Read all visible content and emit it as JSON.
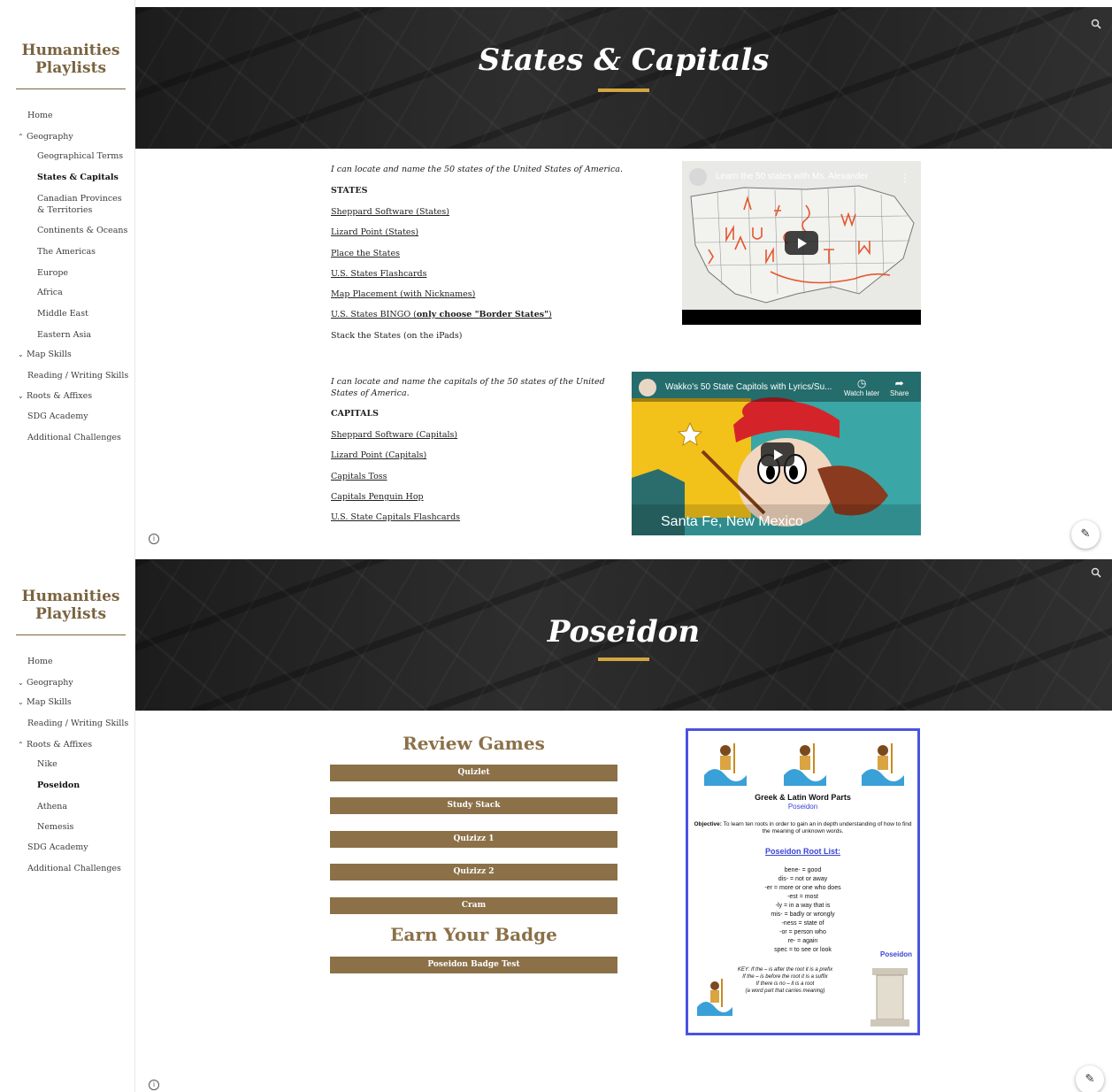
{
  "site": {
    "title_line1": "Humanities",
    "title_line2": "Playlists"
  },
  "screen1": {
    "nav": {
      "home": "Home",
      "geography": "Geography",
      "geo_items": [
        "Geographical Terms",
        "States & Capitals",
        "Canadian Provinces & Territories",
        "Continents & Oceans",
        "The Americas",
        "Europe",
        "Africa",
        "Middle East",
        "Eastern Asia"
      ],
      "map_skills": "Map Skills",
      "reading": "Reading / Writing Skills",
      "roots": "Roots & Affixes",
      "sdg": "SDG Academy",
      "additional": "Additional Challenges"
    },
    "page_title": "States & Capitals",
    "states": {
      "intro": "I can locate and name the 50 states of the United States of America.",
      "heading": "STATES",
      "links": [
        "Sheppard Software (States)",
        "Lizard Point (States)",
        "Place the States",
        "U.S. States Flashcards",
        "Map Placement (with Nicknames)"
      ],
      "bingo_prefix": "U.S. States BINGO (",
      "bingo_emph": "only choose \"Border States\"",
      "bingo_suffix": ")",
      "stack": "Stack the States (on the iPads)"
    },
    "capitals": {
      "intro": "I can locate and name the capitals of the 50 states of the United States of America.",
      "heading": "CAPITALS",
      "links": [
        "Sheppard Software (Capitals)",
        "Lizard Point (Capitals)",
        "Capitals Toss",
        "Capitals Penguin Hop",
        "U.S. State Capitals Flashcards"
      ]
    },
    "video1": {
      "title": "Learn the 50 states with Ms. Alexander"
    },
    "video2": {
      "title": "Wakko's 50 State Capitols with Lyrics/Su...",
      "watch_later": "Watch later",
      "share": "Share",
      "caption": "Santa Fe, New Mexico"
    }
  },
  "screen2": {
    "nav": {
      "home": "Home",
      "geography": "Geography",
      "map_skills": "Map Skills",
      "reading": "Reading / Writing Skills",
      "roots": "Roots & Affixes",
      "roots_items": [
        "Nike",
        "Poseidon",
        "Athena",
        "Nemesis"
      ],
      "sdg": "SDG Academy",
      "additional": "Additional Challenges"
    },
    "page_title": "Poseidon",
    "review_heading": "Review Games",
    "games": [
      "Quizlet",
      "Study Stack",
      "Quizizz 1",
      "Quizizz 2",
      "Cram"
    ],
    "badge_heading": "Earn Your Badge",
    "badge_button": "Poseidon Badge Test",
    "poster": {
      "title": "Greek & Latin Word Parts",
      "subtitle": "Poseidon",
      "objective_label": "Objective:",
      "objective": "To learn ten roots in order to gain an in depth understanding of how to find the meaning of unknown words.",
      "list_title": "Poseidon Root List:",
      "roots": [
        "bene- = good",
        "dis- = not or away",
        "-er = more or one who does",
        "-est = most",
        "-ly = in a way that is",
        "mis- = badly or wrongly",
        "-ness = state of",
        "-or = person who",
        "re- = again",
        "spec = to see or look"
      ],
      "side_label": "Poseidon",
      "key": [
        "KEY: If the – is after the root it is a prefix",
        "If the – is before the root it is a suffix",
        "If there is no – it is a root",
        "(a word part that carries meaning)"
      ]
    }
  },
  "colors": {
    "accent_brown": "#8b7048",
    "title_gold": "#d4a640",
    "poster_border": "#4b53e0"
  },
  "icons": [
    "search-icon",
    "chevron-up-icon",
    "chevron-down-icon",
    "info-icon",
    "pencil-icon",
    "play-icon",
    "clock-icon",
    "share-icon"
  ]
}
